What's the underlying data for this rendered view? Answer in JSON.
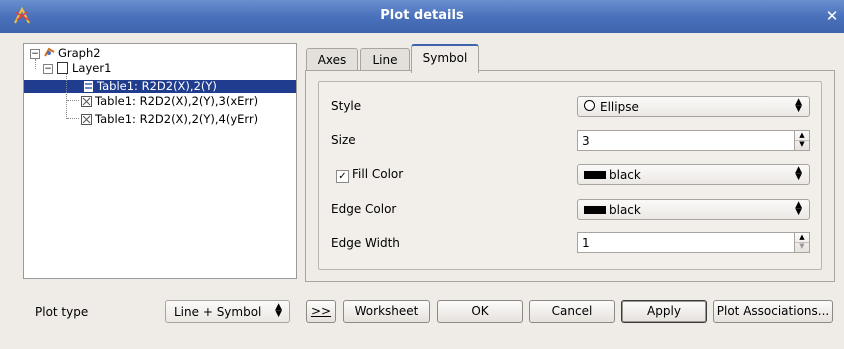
{
  "window": {
    "title": "Plot details"
  },
  "tree": {
    "items": [
      {
        "label": "Graph2"
      },
      {
        "label": "Layer1"
      },
      {
        "label": "Table1: R2D2(X),2(Y)"
      },
      {
        "label": "Table1: R2D2(X),2(Y),3(xErr)"
      },
      {
        "label": "Table1: R2D2(X),2(Y),4(yErr)"
      }
    ]
  },
  "tabs": [
    {
      "label": "Axes"
    },
    {
      "label": "Line"
    },
    {
      "label": "Symbol"
    }
  ],
  "symbol": {
    "style_label": "Style",
    "style_value": "Ellipse",
    "size_label": "Size",
    "size_value": "3",
    "fill_label": "Fill Color",
    "fill_value": "black",
    "edge_color_label": "Edge Color",
    "edge_color_value": "black",
    "edge_width_label": "Edge Width",
    "edge_width_value": "1"
  },
  "bottom": {
    "plot_type_label": "Plot type",
    "plot_type_value": "Line + Symbol",
    "more_label": ">>",
    "worksheet_label": "Worksheet",
    "ok_label": "OK",
    "cancel_label": "Cancel",
    "apply_label": "Apply",
    "plot_assoc_label": "Plot Associations..."
  },
  "colors": {
    "titlebar": "#4a71bb",
    "selection": "#1f3c8f",
    "fill_color": "#000000"
  }
}
